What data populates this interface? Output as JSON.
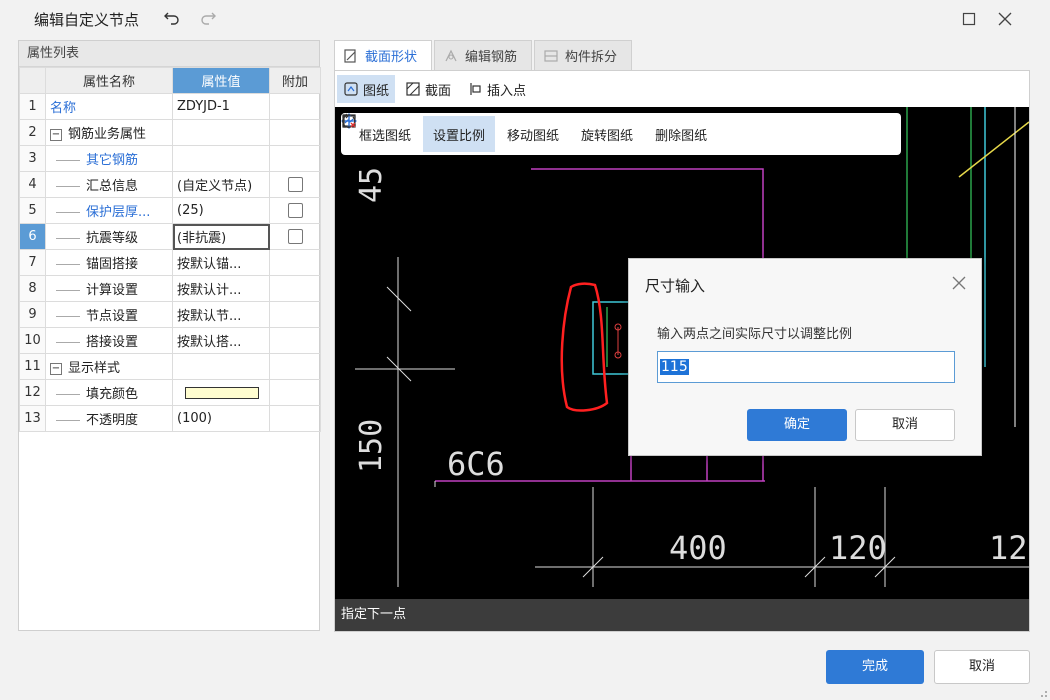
{
  "window": {
    "title": "编辑自定义节点"
  },
  "properties_panel": {
    "title": "属性列表",
    "columns": [
      "属性名称",
      "属性值",
      "附加"
    ],
    "rows": [
      {
        "num": "1",
        "name": "名称",
        "value": "ZDYJD-1"
      },
      {
        "num": "2",
        "name": "钢筋业务属性",
        "value": ""
      },
      {
        "num": "3",
        "name": "其它钢筋",
        "value": ""
      },
      {
        "num": "4",
        "name": "汇总信息",
        "value": "(自定义节点)"
      },
      {
        "num": "5",
        "name": "保护层厚...",
        "value": "(25)"
      },
      {
        "num": "6",
        "name": "抗震等级",
        "value": "(非抗震)"
      },
      {
        "num": "7",
        "name": "锚固搭接",
        "value": "按默认锚..."
      },
      {
        "num": "8",
        "name": "计算设置",
        "value": "按默认计..."
      },
      {
        "num": "9",
        "name": "节点设置",
        "value": "按默认节..."
      },
      {
        "num": "10",
        "name": "搭接设置",
        "value": "按默认搭..."
      },
      {
        "num": "11",
        "name": "显示样式",
        "value": ""
      },
      {
        "num": "12",
        "name": "填充颜色",
        "value": ""
      },
      {
        "num": "13",
        "name": "不透明度",
        "value": "(100)"
      }
    ],
    "fill_color": "#fffdd0"
  },
  "tabs": [
    {
      "label": "截面形状"
    },
    {
      "label": "编辑钢筋"
    },
    {
      "label": "构件拆分"
    }
  ],
  "subtabs": [
    {
      "label": "图纸"
    },
    {
      "label": "截面"
    },
    {
      "label": "插入点"
    }
  ],
  "canvas_toolbar": [
    {
      "label": "框选图纸"
    },
    {
      "label": "设置比例"
    },
    {
      "label": "移动图纸"
    },
    {
      "label": "旋转图纸"
    },
    {
      "label": "删除图纸"
    }
  ],
  "drawing_labels": {
    "dim_45": "45",
    "dim_150": "150",
    "rebar": "6C6",
    "dim_400": "400",
    "dim_120": "120",
    "dim_12": "12"
  },
  "status_text": "指定下一点",
  "dialog": {
    "title": "尺寸输入",
    "prompt": "输入两点之间实际尺寸以调整比例",
    "value": "115",
    "ok": "确定",
    "cancel": "取消"
  },
  "footer": {
    "finish": "完成",
    "cancel": "取消"
  },
  "colors": {
    "accent": "#2f7ad6",
    "header_blue": "#5b9bd5",
    "canvas_bg": "#000000"
  }
}
